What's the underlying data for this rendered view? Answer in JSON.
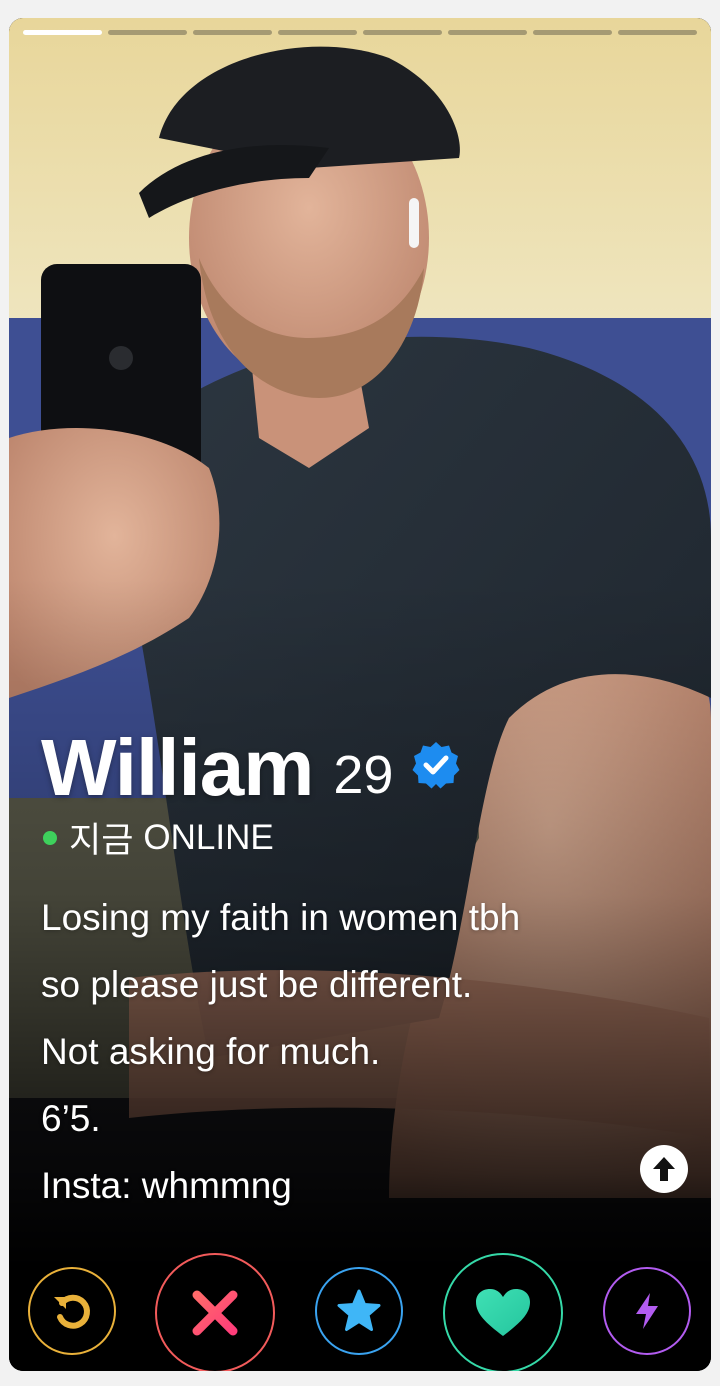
{
  "profile": {
    "name": "William",
    "age": "29",
    "verified": true,
    "status": {
      "time": "지금",
      "label": "ONLINE"
    },
    "bio_lines": [
      "Losing my faith in women tbh",
      "so please just be different.",
      "Not asking for much.",
      "6’5.",
      "Insta: whmmng"
    ],
    "photo_count": 8,
    "current_photo": 1
  },
  "icons": {
    "verified": "verified-badge-icon",
    "info": "arrow-up-icon",
    "rewind": "rewind-icon",
    "nope": "close-icon",
    "super_like": "star-icon",
    "like": "heart-icon",
    "boost": "lightning-icon"
  },
  "colors": {
    "online": "#3ed15c",
    "verified": "#1d8cf0",
    "rewind": "#e9b13a",
    "nope": "#f25b5b",
    "super_like": "#3aa3f0",
    "like": "#35d9a8",
    "boost": "#b25cf0"
  }
}
